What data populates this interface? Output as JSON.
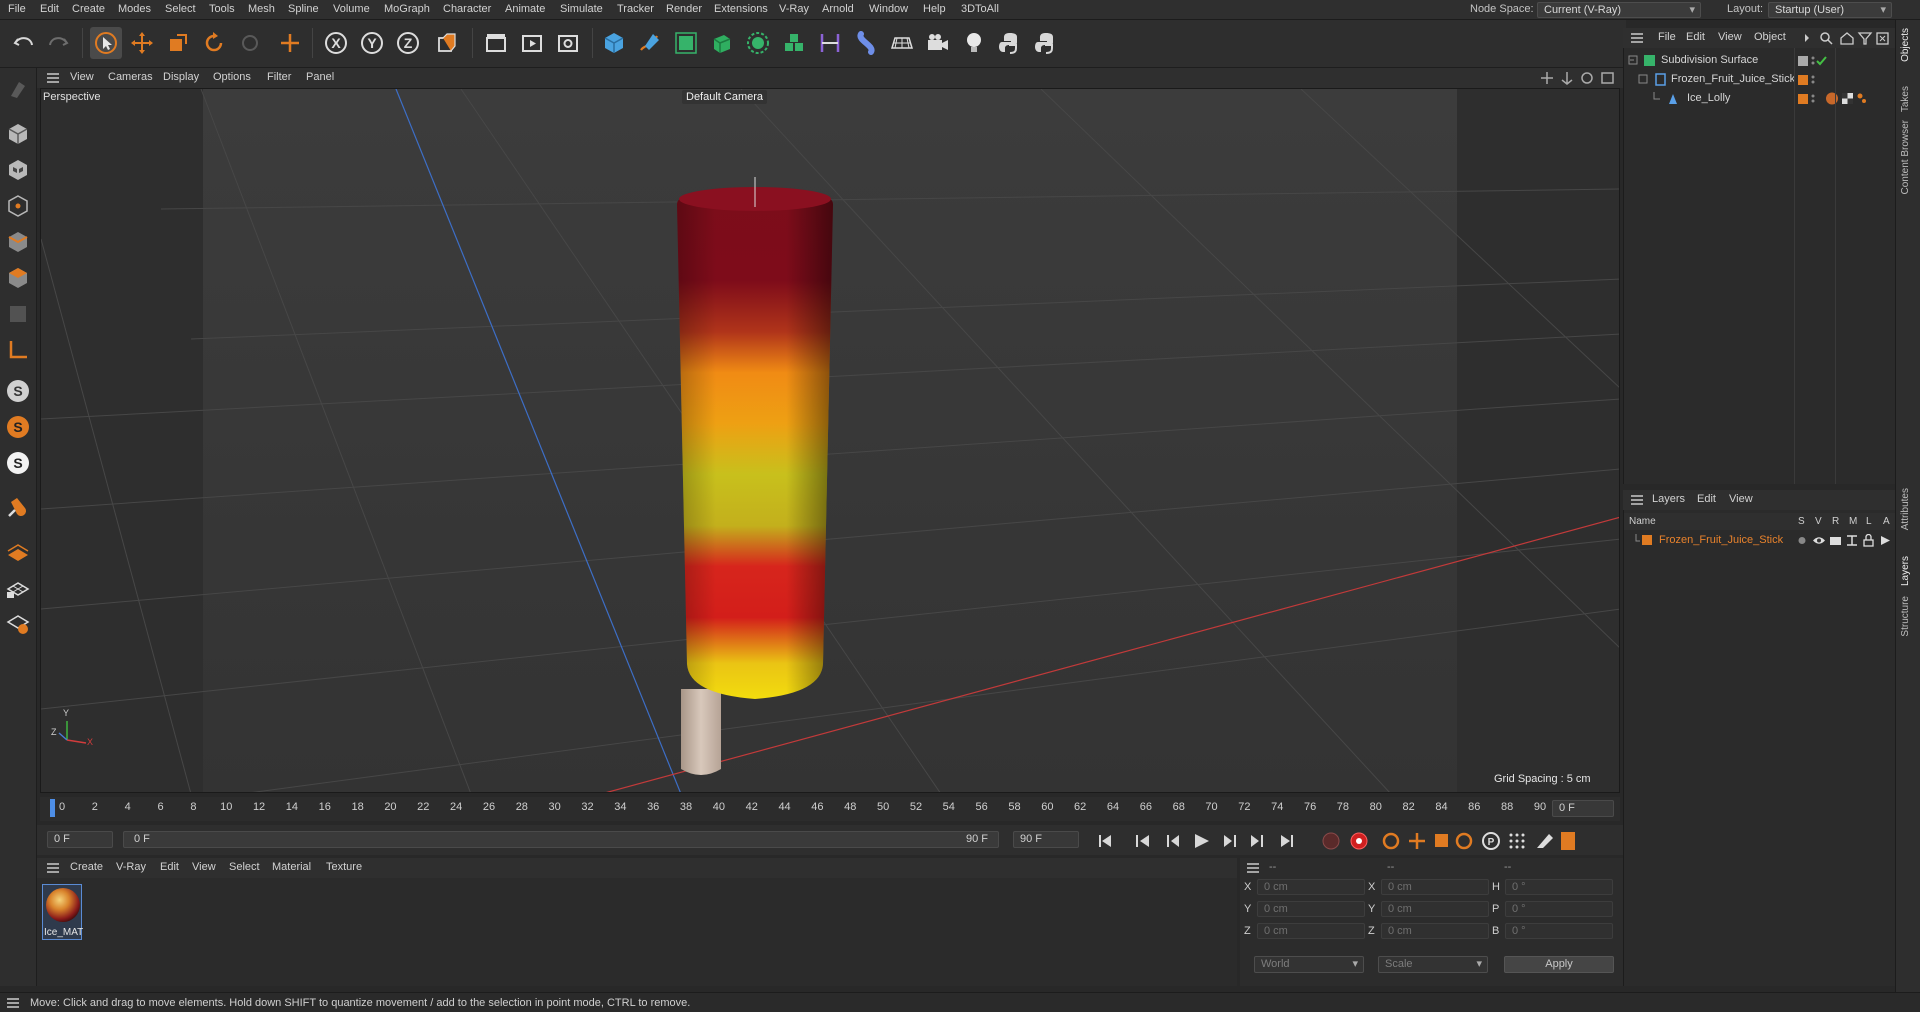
{
  "menubar": {
    "items": [
      "File",
      "Edit",
      "Create",
      "Modes",
      "Select",
      "Tools",
      "Mesh",
      "Spline",
      "Volume",
      "MoGraph",
      "Character",
      "Animate",
      "Simulate",
      "Tracker",
      "Render",
      "Extensions",
      "V-Ray",
      "Arnold",
      "Window",
      "Help",
      "3DToAll"
    ],
    "node_space_label": "Node Space:",
    "node_space_value": "Current (V-Ray)",
    "layout_label": "Layout:",
    "layout_value": "Startup (User)"
  },
  "viewport": {
    "menu": [
      "View",
      "Cameras",
      "Display",
      "Options",
      "Filter",
      "Panel"
    ],
    "view_label": "Perspective",
    "camera_label": "Default Camera",
    "grid_spacing": "Grid Spacing : 5 cm",
    "axis_y": "Y",
    "axis_x": "X",
    "axis_z": "Z"
  },
  "timeline": {
    "ticks": [
      "0",
      "2",
      "4",
      "6",
      "8",
      "10",
      "12",
      "14",
      "16",
      "18",
      "20",
      "22",
      "24",
      "26",
      "28",
      "30",
      "32",
      "34",
      "36",
      "38",
      "40",
      "42",
      "44",
      "46",
      "48",
      "50",
      "52",
      "54",
      "56",
      "58",
      "60",
      "62",
      "64",
      "66",
      "68",
      "70",
      "72",
      "74",
      "76",
      "78",
      "80",
      "82",
      "84",
      "86",
      "88",
      "90"
    ],
    "current_frame": "0 F",
    "start_frame": "0 F",
    "range_start": "0 F",
    "range_end": "90 F",
    "end_frame": "90 F"
  },
  "material_manager": {
    "menu": [
      "Create",
      "V-Ray",
      "Edit",
      "View",
      "Select",
      "Material",
      "Texture"
    ],
    "materials": [
      {
        "name": "Ice_MAT"
      }
    ]
  },
  "coordinates": {
    "header_a": "--",
    "header_b": "--",
    "header_c": "--",
    "rows": [
      {
        "pos_label": "X",
        "pos": "0 cm",
        "size_label": "X",
        "size": "0 cm",
        "rot_label": "H",
        "rot": "0 °"
      },
      {
        "pos_label": "Y",
        "pos": "0 cm",
        "size_label": "Y",
        "size": "0 cm",
        "rot_label": "P",
        "rot": "0 °"
      },
      {
        "pos_label": "Z",
        "pos": "0 cm",
        "size_label": "Z",
        "size": "0 cm",
        "rot_label": "B",
        "rot": "0 °"
      }
    ],
    "space": "World",
    "mode": "Scale",
    "apply_label": "Apply"
  },
  "objects_panel": {
    "menu": [
      "File",
      "Edit",
      "View",
      "Object"
    ],
    "items": [
      {
        "name": "Subdivision Surface",
        "indent": 0
      },
      {
        "name": "Frozen_Fruit_Juice_Stick",
        "indent": 1
      },
      {
        "name": "Ice_Lolly",
        "indent": 2
      }
    ]
  },
  "layers_panel": {
    "menu": [
      "Layers",
      "Edit",
      "View"
    ],
    "columns": [
      "Name",
      "S",
      "V",
      "R",
      "M",
      "L",
      "A"
    ],
    "layers": [
      {
        "name": "Frozen_Fruit_Juice_Stick"
      }
    ]
  },
  "right_tabs": [
    "Objects",
    "Takes",
    "Content Browser",
    "Attributes",
    "Layers",
    "Structure"
  ],
  "status": "Move: Click and drag to move elements. Hold down SHIFT to quantize movement / add to the selection in point mode, CTRL to remove.",
  "colors": {
    "accent_orange": "#e07b22",
    "layer_text": "#e8822c",
    "x_axis": "#d23c3c",
    "z_axis": "#3c6ed2"
  }
}
